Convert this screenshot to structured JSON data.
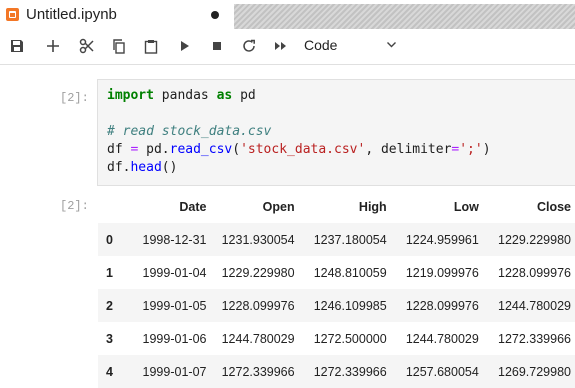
{
  "tab": {
    "title": "Untitled.ipynb"
  },
  "toolbar": {
    "buttons": [
      "save",
      "insert-cell",
      "cut",
      "copy",
      "paste",
      "run",
      "stop",
      "restart",
      "run-all"
    ],
    "cell_type": "Code"
  },
  "cells": {
    "input_prompt": "[2]:",
    "output_prompt": "[2]:",
    "code": {
      "line1": {
        "kw1": "import",
        "t1": " pandas ",
        "kw2": "as",
        "t2": " pd"
      },
      "line2": {
        "comment": "# read stock_data.csv"
      },
      "line3": {
        "t1": "df ",
        "eq": "=",
        "t2": " pd.",
        "fn": "read_csv",
        "t3": "(",
        "s1": "'stock_data.csv'",
        "t4": ", delimiter",
        "eq2": "=",
        "s2": "';'",
        "t5": ")"
      },
      "line4": {
        "t1": "df.",
        "fn": "head",
        "t2": "()"
      }
    }
  },
  "table": {
    "columns": [
      "",
      "Date",
      "Open",
      "High",
      "Low",
      "Close"
    ],
    "rows": [
      {
        "index": "0",
        "Date": "1998-12-31",
        "Open": "1231.930054",
        "High": "1237.180054",
        "Low": "1224.959961",
        "Close": "1229.229980"
      },
      {
        "index": "1",
        "Date": "1999-01-04",
        "Open": "1229.229980",
        "High": "1248.810059",
        "Low": "1219.099976",
        "Close": "1228.099976"
      },
      {
        "index": "2",
        "Date": "1999-01-05",
        "Open": "1228.099976",
        "High": "1246.109985",
        "Low": "1228.099976",
        "Close": "1244.780029"
      },
      {
        "index": "3",
        "Date": "1999-01-06",
        "Open": "1244.780029",
        "High": "1272.500000",
        "Low": "1244.780029",
        "Close": "1272.339966"
      },
      {
        "index": "4",
        "Date": "1999-01-07",
        "Open": "1272.339966",
        "High": "1272.339966",
        "Low": "1257.680054",
        "Close": "1269.729980"
      }
    ]
  }
}
